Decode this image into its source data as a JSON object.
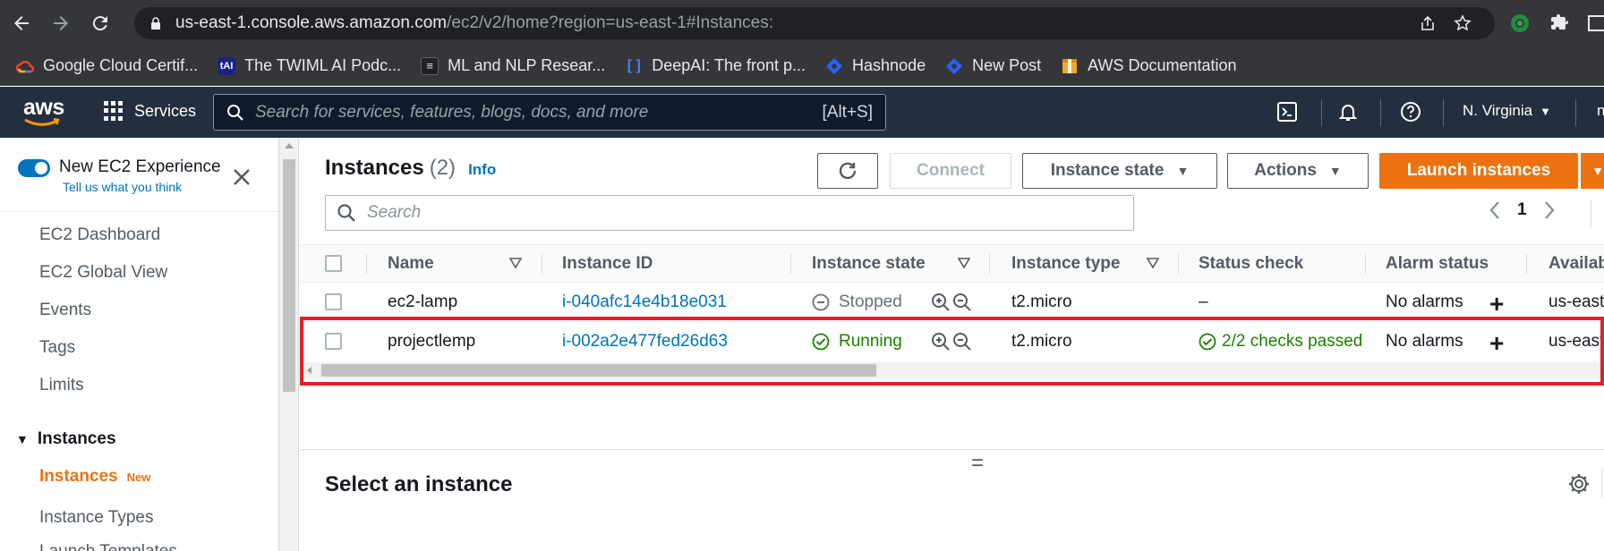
{
  "browser": {
    "url_host": "us-east-1.console.aws.amazon.com",
    "url_path": "/ec2/v2/home?region=us-east-1#Instances:",
    "bookmarks": [
      {
        "label": "Google Cloud Certif...",
        "icon": "google-cloud-icon"
      },
      {
        "label": "The TWIML AI Podc...",
        "icon": "twiml-icon"
      },
      {
        "label": "ML and NLP Resear...",
        "icon": "ml-nlp-icon"
      },
      {
        "label": "DeepAI: The front p...",
        "icon": "deepai-icon"
      },
      {
        "label": "Hashnode",
        "icon": "hashnode-icon"
      },
      {
        "label": "New Post",
        "icon": "hashnode-icon"
      },
      {
        "label": "AWS Documentation",
        "icon": "aws-docs-icon"
      }
    ]
  },
  "aws_header": {
    "logo": "aws",
    "services_label": "Services",
    "search_placeholder": "Search for services, features, blogs, docs, and more",
    "search_shortcut": "[Alt+S]",
    "region": "N. Virginia",
    "user_cut": "n"
  },
  "sidebar": {
    "new_experience": "New EC2 Experience",
    "feedback_link": "Tell us what you think",
    "items": [
      "EC2 Dashboard",
      "EC2 Global View",
      "Events",
      "Tags",
      "Limits"
    ],
    "section": "Instances",
    "active_item": "Instances",
    "active_badge": "New",
    "sub_items": [
      "Instance Types",
      "Launch Templates"
    ]
  },
  "main": {
    "title": "Instances",
    "count": "(2)",
    "info": "Info",
    "buttons": {
      "connect": "Connect",
      "instance_state": "Instance state",
      "actions": "Actions",
      "launch": "Launch instances"
    },
    "search_placeholder": "Search",
    "page": "1",
    "columns": [
      "Name",
      "Instance ID",
      "Instance state",
      "Instance type",
      "Status check",
      "Alarm status",
      "Availab"
    ],
    "rows": [
      {
        "name": "ec2-lamp",
        "id": "i-040afc14e4b18e031",
        "state": "Stopped",
        "type": "t2.micro",
        "status": "–",
        "alarm": "No alarms",
        "az": "us-east"
      },
      {
        "name": "projectlemp",
        "id": "i-002a2e477fed26d63",
        "state": "Running",
        "type": "t2.micro",
        "status": "2/2 checks passed",
        "alarm": "No alarms",
        "az": "us-east"
      }
    ],
    "split_handle": "=",
    "detail_title": "Select an instance"
  },
  "colors": {
    "aws_nav": "#232f3e",
    "aws_orange": "#ec7211",
    "link_blue": "#0073bb",
    "running_green": "#1d8102",
    "highlight_red": "#e0202a"
  }
}
